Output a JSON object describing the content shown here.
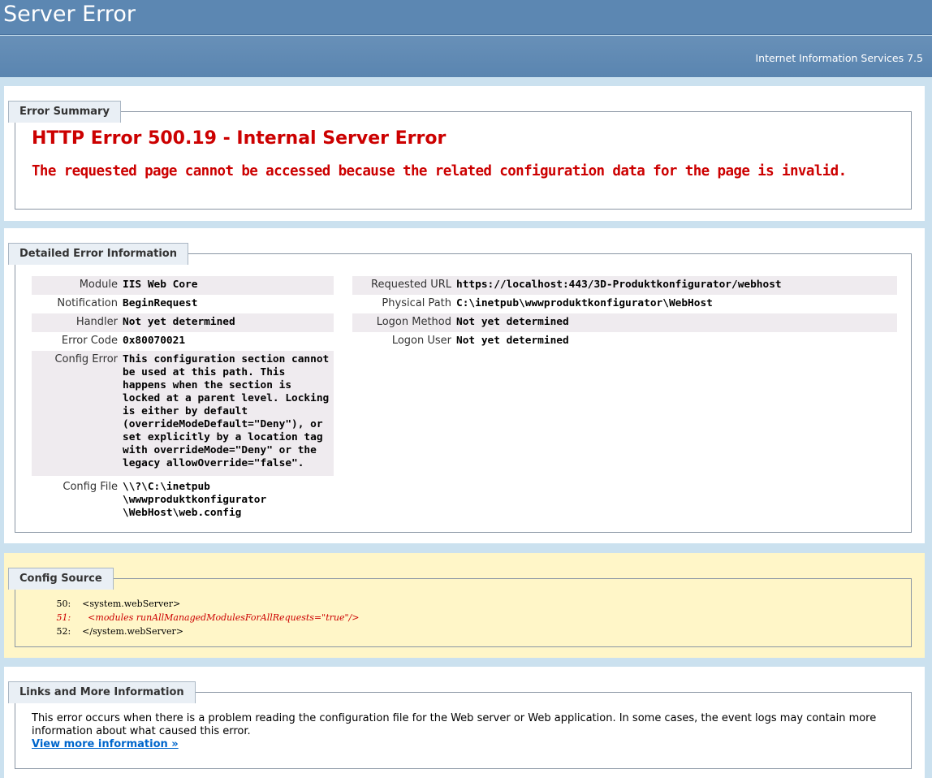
{
  "header": {
    "title": "Server Error",
    "server": "Internet Information Services 7.5"
  },
  "summary": {
    "legend": "Error Summary",
    "error_title": "HTTP Error 500.19 - Internal Server Error",
    "error_message": "The requested page cannot be accessed because the related configuration data for the page is invalid."
  },
  "detail": {
    "legend": "Detailed Error Information",
    "left": [
      {
        "label": "Module",
        "value": "IIS Web Core"
      },
      {
        "label": "Notification",
        "value": "BeginRequest"
      },
      {
        "label": "Handler",
        "value": "Not yet determined"
      },
      {
        "label": "Error Code",
        "value": "0x80070021"
      },
      {
        "label": "Config Error",
        "value": "This configuration section cannot be used at this path. This happens when the section is locked at a parent level. Locking is either by default (overrideModeDefault=\"Deny\"), or set explicitly by a location tag with overrideMode=\"Deny\" or the legacy allowOverride=\"false\"."
      },
      {
        "label": "Config File",
        "value": "\\\\?\\C:\\inetpub \\wwwproduktkonfigurator \\WebHost\\web.config"
      }
    ],
    "right": [
      {
        "label": "Requested URL",
        "value": "https://localhost:443/3D-Produktkonfigurator/webhost"
      },
      {
        "label": "Physical Path",
        "value": "C:\\inetpub\\wwwproduktkonfigurator\\WebHost"
      },
      {
        "label": "Logon Method",
        "value": "Not yet determined"
      },
      {
        "label": "Logon User",
        "value": "Not yet determined"
      }
    ]
  },
  "config_source": {
    "legend": "Config Source",
    "lines": [
      "   50:    <system.webServer>",
      "   51:      <modules runAllManagedModulesForAllRequests=\"true\"/>",
      "   52:    </system.webServer>"
    ]
  },
  "links": {
    "legend": "Links and More Information",
    "text": "This error occurs when there is a problem reading the configuration file for the Web server or Web application. In some cases, the event logs may contain more information about what caused this error.",
    "more_link": "View more information »"
  }
}
